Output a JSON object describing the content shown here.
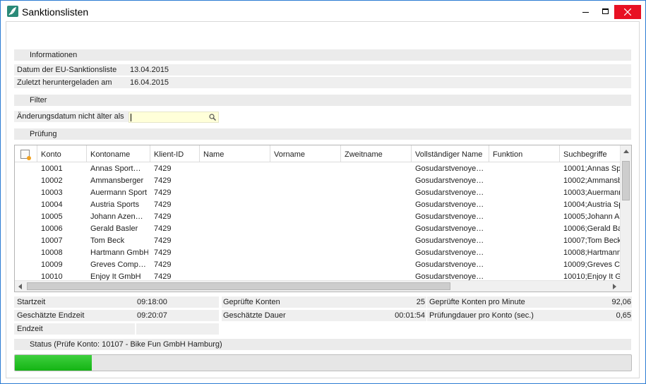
{
  "window": {
    "title": "Sanktionslisten",
    "accent": "#2b7cd3"
  },
  "sections": {
    "info": "Informationen",
    "filter": "Filter",
    "check": "Prüfung"
  },
  "info": {
    "date_label": "Datum der EU-Sanktionsliste",
    "date_value": "13.04.2015",
    "download_label": "Zuletzt heruntergeladen am",
    "download_value": "16.04.2015"
  },
  "filter": {
    "label": "Änderungsdatum nicht älter als",
    "value": ""
  },
  "grid": {
    "columns": [
      "Konto",
      "Kontoname",
      "Klient-ID",
      "Name",
      "Vorname",
      "Zweitname",
      "Vollständiger Name",
      "Funktion",
      "Suchbegriffe"
    ],
    "rows": [
      [
        "10001",
        "Annas Sport…",
        "7429",
        "",
        "",
        "",
        "Gosudarstvenoye…",
        "",
        "10001;Annas Sp"
      ],
      [
        "10002",
        "Ammansberger",
        "7429",
        "",
        "",
        "",
        "Gosudarstvenoye…",
        "",
        "10002;Ammansb"
      ],
      [
        "10003",
        "Auermann Sport",
        "7429",
        "",
        "",
        "",
        "Gosudarstvenoye…",
        "",
        "10003;Auermann"
      ],
      [
        "10004",
        "Austria Sports",
        "7429",
        "",
        "",
        "",
        "Gosudarstvenoye…",
        "",
        "10004;Austria Sp"
      ],
      [
        "10005",
        "Johann Azen…",
        "7429",
        "",
        "",
        "",
        "Gosudarstvenoye…",
        "",
        "10005;Johann A"
      ],
      [
        "10006",
        "Gerald Basler",
        "7429",
        "",
        "",
        "",
        "Gosudarstvenoye…",
        "",
        "10006;Gerald Ba"
      ],
      [
        "10007",
        "Tom Beck",
        "7429",
        "",
        "",
        "",
        "Gosudarstvenoye…",
        "",
        "10007;Tom Beck"
      ],
      [
        "10008",
        "Hartmann GmbH",
        "7429",
        "",
        "",
        "",
        "Gosudarstvenoye…",
        "",
        "10008;Hartmann"
      ],
      [
        "10009",
        "Greves Comp…",
        "7429",
        "",
        "",
        "",
        "Gosudarstvenoye…",
        "",
        "10009;Greves C"
      ],
      [
        "10010",
        "Enjoy It GmbH",
        "7429",
        "",
        "",
        "",
        "Gosudarstvenoye…",
        "",
        "10010;Enjoy It G"
      ]
    ]
  },
  "stats": {
    "start_label": "Startzeit",
    "start_value": "09:18:00",
    "est_end_label": "Geschätzte Endzeit",
    "est_end_value": "09:20:07",
    "end_label": "Endzeit",
    "end_value": "",
    "checked_label": "Geprüfte Konten",
    "checked_value": "25",
    "est_duration_label": "Geschätzte Dauer",
    "est_duration_value": "00:01:54",
    "per_minute_label": "Geprüfte Konten pro Minute",
    "per_minute_value": "92,06",
    "per_account_label": "Prüfungdauer pro Konto (sec.)",
    "per_account_value": "0,65"
  },
  "status": {
    "text": "Status (Prüfe Konto: 10107 - Bike  Fun GmbH Hamburg)"
  },
  "progress": {
    "fraction": 0.125,
    "color": "#14b414"
  }
}
